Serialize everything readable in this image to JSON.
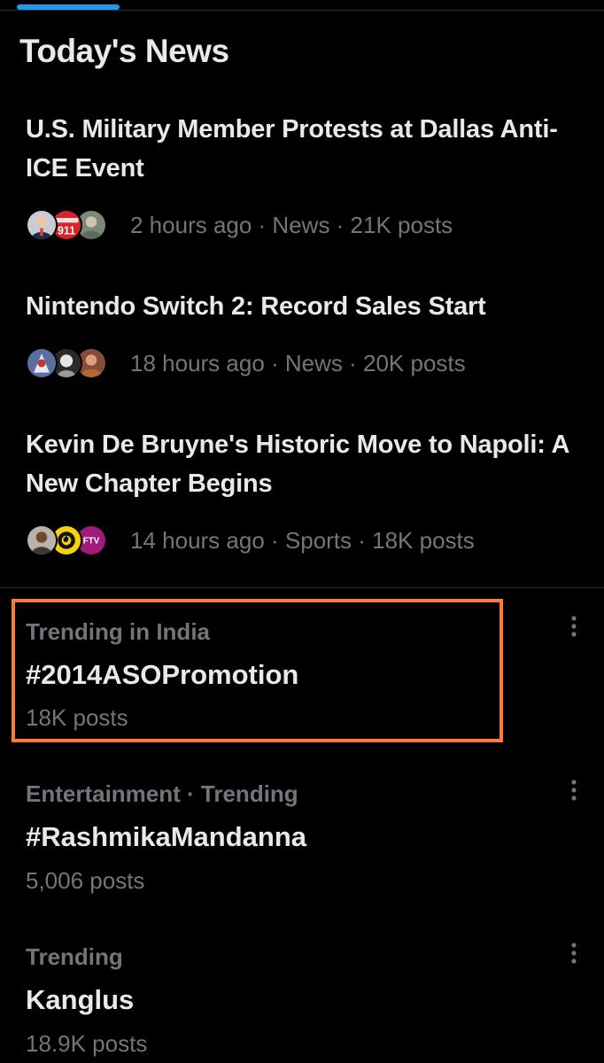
{
  "section": {
    "title": "Today's News"
  },
  "news": [
    {
      "headline": "U.S. Military Member Protests at Dallas Anti-ICE Event",
      "meta": "2 hours ago · News · 21K posts",
      "avatars": [
        "person-avatar",
        "breaking-news-logo-avatar",
        "person-avatar"
      ]
    },
    {
      "headline": "Nintendo Switch 2: Record Sales Start",
      "meta": "18 hours ago · News · 20K posts",
      "avatars": [
        "character-avatar",
        "person-avatar",
        "person-avatar"
      ]
    },
    {
      "headline": "Kevin De Bruyne's Historic Move to Napoli: A New Chapter Begins",
      "meta": "14 hours ago · Sports · 18K posts",
      "avatars": [
        "person-avatar",
        "football-logo-avatar",
        "ftv-logo-avatar"
      ],
      "ftv_label": "FTV"
    }
  ],
  "trends": [
    {
      "context": "Trending in India",
      "name": "#2014ASOPromotion",
      "count": "18K posts"
    },
    {
      "context": "Entertainment · Trending",
      "name": "#RashmikaMandanna",
      "count": "5,006 posts"
    },
    {
      "context": "Trending",
      "name": "Kanglus",
      "count": "18.9K posts"
    }
  ],
  "colors": {
    "background": "#000000",
    "primary_text": "#e7e9ea",
    "secondary_text": "#71767b",
    "accent": "#1d9bf0",
    "highlight": "#ff7a3a",
    "divider": "#2f3336"
  },
  "icons": {
    "more": "more-vertical-icon"
  }
}
